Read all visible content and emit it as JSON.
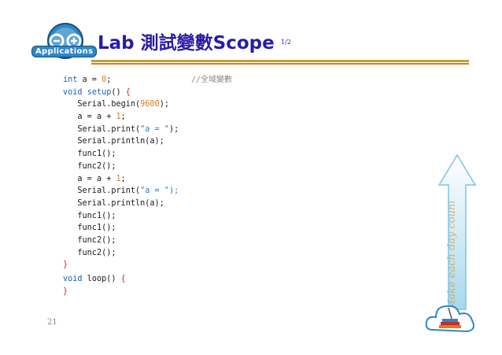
{
  "header": {
    "logo_text": "Applications",
    "title": "Lab 測試變數Scope",
    "page_indicator": "1/2"
  },
  "code": {
    "lines": [
      {
        "indent": "",
        "parts": [
          {
            "t": "int",
            "c": "kw"
          },
          {
            "t": " a = "
          },
          {
            "t": "0",
            "c": "num"
          },
          {
            "t": ";"
          }
        ]
      },
      {
        "indent": "",
        "parts": [
          {
            "t": "void",
            "c": "kw"
          },
          {
            "t": " "
          },
          {
            "t": "setup",
            "c": "kw"
          },
          {
            "t": "() "
          },
          {
            "t": "{",
            "c": "red"
          }
        ]
      },
      {
        "indent": "   ",
        "parts": [
          {
            "t": "Serial.begin("
          },
          {
            "t": "9600",
            "c": "num"
          },
          {
            "t": ");"
          }
        ]
      },
      {
        "indent": "   ",
        "parts": [
          {
            "t": "a = a + "
          },
          {
            "t": "1",
            "c": "num"
          },
          {
            "t": ";"
          }
        ]
      },
      {
        "indent": "   ",
        "parts": [
          {
            "t": "Serial.print("
          },
          {
            "t": "\"a = \"",
            "c": "str"
          },
          {
            "t": ");"
          }
        ]
      },
      {
        "indent": "   ",
        "parts": [
          {
            "t": "Serial.println(a);"
          }
        ]
      },
      {
        "indent": "   ",
        "parts": [
          {
            "t": "func1();"
          }
        ]
      },
      {
        "indent": "   ",
        "parts": [
          {
            "t": "func2();"
          }
        ]
      },
      {
        "indent": "   ",
        "parts": [
          {
            "t": "a = a + "
          },
          {
            "t": "1",
            "c": "num"
          },
          {
            "t": ";"
          }
        ]
      },
      {
        "indent": "   ",
        "parts": [
          {
            "t": "Serial.print("
          },
          {
            "t": "\"a = \");",
            "c": "str"
          }
        ]
      },
      {
        "indent": "   ",
        "parts": [
          {
            "t": "Serial.println(a);"
          }
        ]
      },
      {
        "indent": "   ",
        "parts": [
          {
            "t": "func1();"
          }
        ]
      },
      {
        "indent": "   ",
        "parts": [
          {
            "t": "func1();"
          }
        ]
      },
      {
        "indent": "   ",
        "parts": [
          {
            "t": "func2();"
          }
        ]
      },
      {
        "indent": "   ",
        "parts": [
          {
            "t": "func2();"
          }
        ]
      },
      {
        "indent": "",
        "parts": [
          {
            "t": "}",
            "c": "red"
          }
        ]
      },
      {
        "indent": "",
        "parts": [
          {
            "t": "void",
            "c": "kw"
          },
          {
            "t": " loop() "
          },
          {
            "t": "{",
            "c": "red"
          }
        ]
      },
      {
        "indent": "",
        "parts": [
          {
            "t": "}",
            "c": "red"
          }
        ]
      }
    ],
    "comment": "//全域變數"
  },
  "motto": "Make each day count",
  "footer": {
    "page_number": "21"
  },
  "colors": {
    "title": "#2a1ba8",
    "keyword": "#1b5fb3",
    "number": "#e07a1d",
    "string": "#2b7bc9",
    "brace": "#c62d2d"
  },
  "icons": [
    "arduino-logo-icon",
    "arrow-up-icon",
    "cloud-books-icon"
  ]
}
